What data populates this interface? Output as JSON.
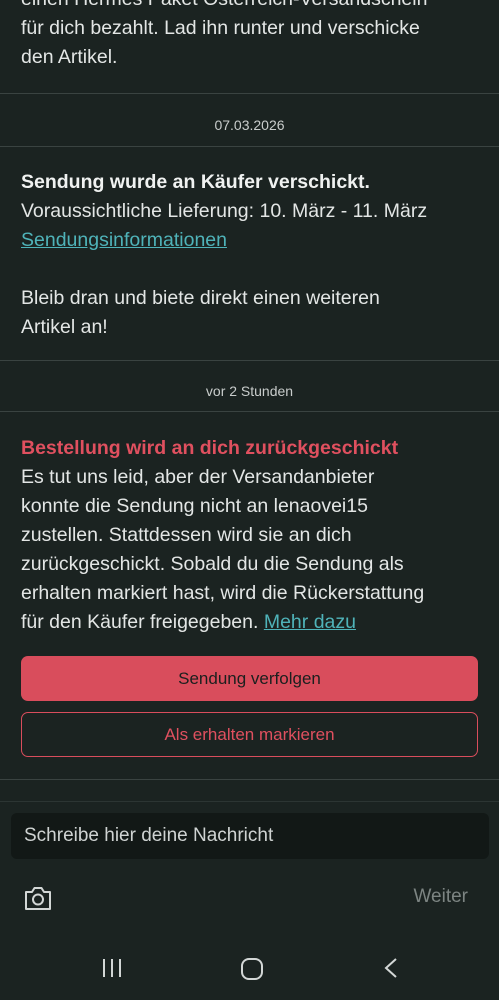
{
  "messages": {
    "top_partial": {
      "lines": [
        "einen Hermes Paket Österreich-Versandschein",
        "für dich bezahlt. Lad ihn runter und verschicke",
        "den Artikel."
      ]
    },
    "date_1": "07.03.2026",
    "shipped": {
      "title": "Sendung wurde an Käufer verschickt.",
      "delivery": "Voraussichtliche Lieferung: 10. März - 11. März",
      "link": "Sendungsinformationen",
      "note_line1": "Bleib dran und biete direkt einen weiteren",
      "note_line2": "Artikel an!"
    },
    "date_2": "vor 2 Stunden",
    "returned": {
      "title": "Bestellung wird an dich zurückgeschickt",
      "lines": [
        "Es tut uns leid, aber der Versandanbieter",
        "konnte die Sendung nicht an lenaovei15",
        "zustellen. Stattdessen wird sie an dich",
        "zurückgeschickt. Sobald du die Sendung als",
        "erhalten markiert hast, wird die Rückerstattung"
      ],
      "last_line": "für den Käufer freigegeben.",
      "link": "Mehr dazu",
      "track_button": "Sendung verfolgen",
      "received_button": "Als erhalten markieren"
    }
  },
  "composer": {
    "placeholder": "Schreibe hier deine Nachricht",
    "send_label": "Weiter",
    "camera_icon": "camera-icon"
  },
  "system_nav": {
    "recents_icon": "recents-icon",
    "home_icon": "home-icon",
    "back_icon": "back-icon"
  },
  "colors": {
    "background": "#1b2321",
    "accent": "#d94d5c",
    "link": "#4fb3b9",
    "divider": "#3a4341"
  }
}
